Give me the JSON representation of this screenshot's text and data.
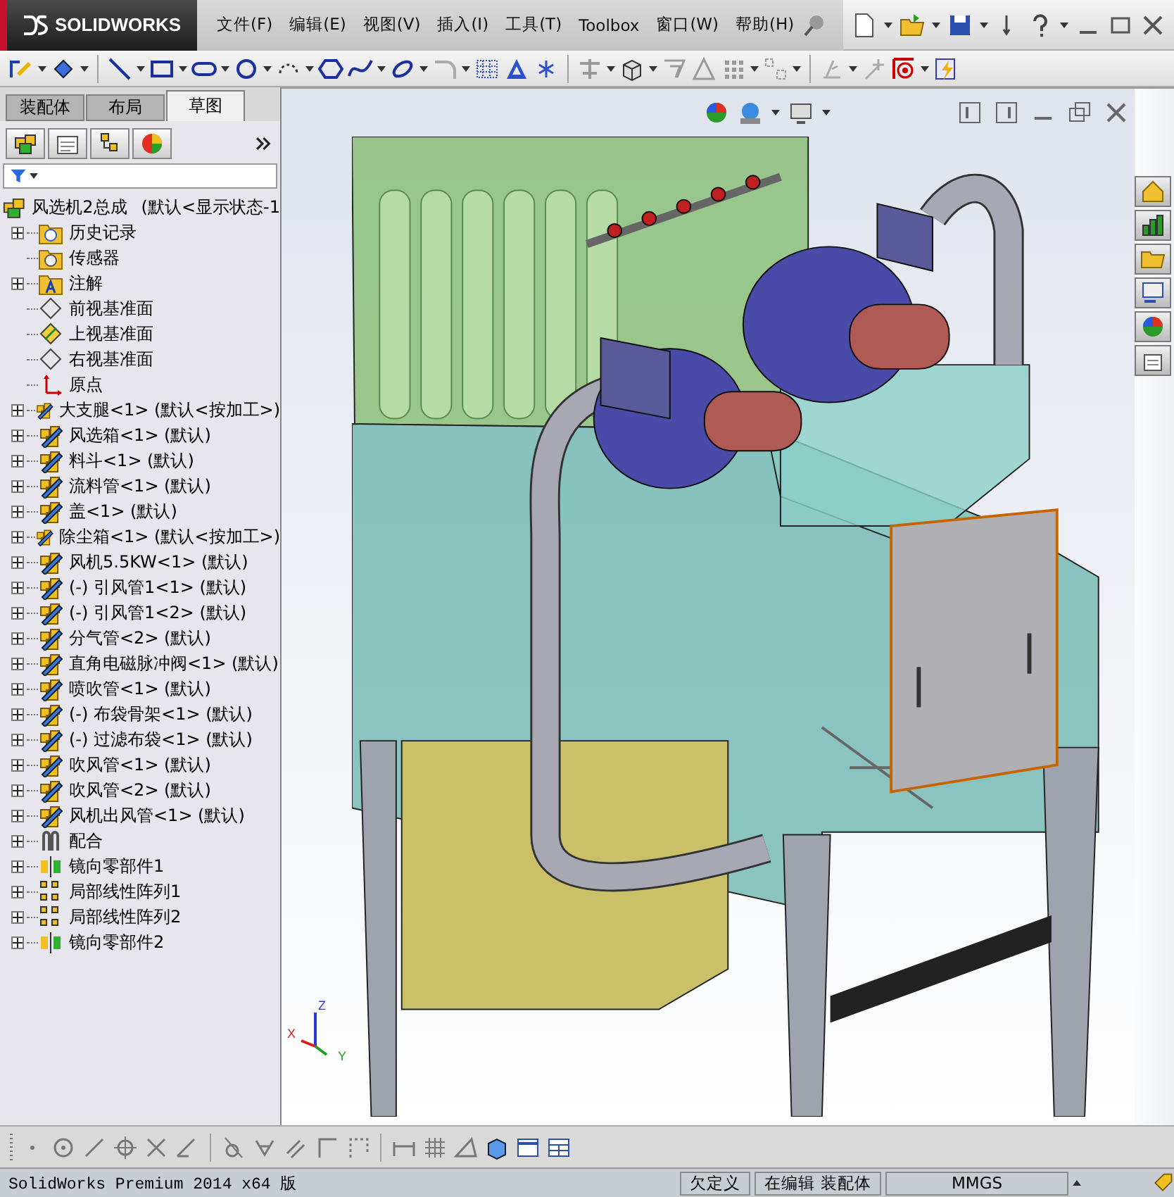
{
  "app": {
    "logo": "SOLIDWORKS"
  },
  "menu": [
    "文件(F)",
    "编辑(E)",
    "视图(V)",
    "插入(I)",
    "工具(T)",
    "Toolbox",
    "窗口(W)",
    "帮助(H)"
  ],
  "panel_tabs": [
    {
      "label": "装配体",
      "selected": false
    },
    {
      "label": "布局",
      "selected": false
    },
    {
      "label": "草图",
      "selected": true
    }
  ],
  "tree": {
    "root": {
      "name": "风选机2总成",
      "config": "(默认<显示状态-1"
    },
    "items": [
      {
        "kind": "folder",
        "name": "历史记录",
        "expander": true
      },
      {
        "kind": "sensor",
        "name": "传感器",
        "expander": false
      },
      {
        "kind": "annotation",
        "name": "注解",
        "expander": true
      },
      {
        "kind": "plane",
        "name": "前视基准面",
        "expander": false,
        "visible": false
      },
      {
        "kind": "plane",
        "name": "上视基准面",
        "expander": false,
        "visible": true
      },
      {
        "kind": "plane",
        "name": "右视基准面",
        "expander": false,
        "visible": false
      },
      {
        "kind": "origin",
        "name": "原点",
        "expander": false
      },
      {
        "kind": "part",
        "name": "大支腿<1> (默认<按加工>)",
        "expander": true
      },
      {
        "kind": "part",
        "name": "风选箱<1> (默认)",
        "expander": true
      },
      {
        "kind": "part",
        "name": "料斗<1> (默认)",
        "expander": true
      },
      {
        "kind": "part",
        "name": "流料管<1> (默认)",
        "expander": true
      },
      {
        "kind": "part",
        "name": "盖<1> (默认)",
        "expander": true
      },
      {
        "kind": "part",
        "name": "除尘箱<1> (默认<按加工>)",
        "expander": true
      },
      {
        "kind": "part",
        "name": "风机5.5KW<1> (默认)",
        "expander": true
      },
      {
        "kind": "part",
        "name": "(-) 引风管1<1> (默认)",
        "expander": true
      },
      {
        "kind": "part",
        "name": "(-) 引风管1<2> (默认)",
        "expander": true
      },
      {
        "kind": "part",
        "name": "分气管<2> (默认)",
        "expander": true
      },
      {
        "kind": "part",
        "name": "直角电磁脉冲阀<1> (默认)",
        "expander": true
      },
      {
        "kind": "part",
        "name": "喷吹管<1> (默认)",
        "expander": true
      },
      {
        "kind": "part",
        "name": "(-) 布袋骨架<1> (默认)",
        "expander": true
      },
      {
        "kind": "part",
        "name": "(-) 过滤布袋<1> (默认)",
        "expander": true
      },
      {
        "kind": "part",
        "name": "吹风管<1> (默认)",
        "expander": true
      },
      {
        "kind": "part",
        "name": "吹风管<2> (默认)",
        "expander": true
      },
      {
        "kind": "part",
        "name": "风机出风管<1> (默认)",
        "expander": true
      },
      {
        "kind": "mates",
        "name": "配合",
        "expander": true
      },
      {
        "kind": "mirror",
        "name": "镜向零部件1",
        "expander": true
      },
      {
        "kind": "pattern",
        "name": "局部线性阵列1",
        "expander": true
      },
      {
        "kind": "pattern",
        "name": "局部线性阵列2",
        "expander": true
      },
      {
        "kind": "mirror",
        "name": "镜向零部件2",
        "expander": true
      }
    ]
  },
  "triad": {
    "x": "X",
    "y": "Y",
    "z": "Z"
  },
  "status_bar": {
    "product": "SolidWorks Premium 2014 x64 版",
    "sketch_state": "欠定义",
    "mode": "在编辑 装配体",
    "units": "MMGS"
  }
}
